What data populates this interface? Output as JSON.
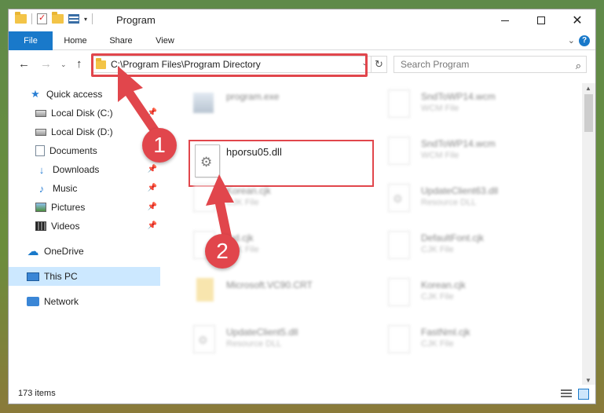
{
  "window": {
    "title": "Program",
    "minimize_glyph": "",
    "maximize_glyph": "",
    "close_glyph": "✕"
  },
  "ribbon": {
    "file": "File",
    "home": "Home",
    "share": "Share",
    "view": "View",
    "expand": "⌄",
    "help": "?"
  },
  "nav": {
    "back": "←",
    "forward": "→",
    "recent": "⌄",
    "up": "↑",
    "address": "C:\\Program Files\\Program Directory",
    "address_dropdown": "⌄",
    "refresh": "↻",
    "search_placeholder": "Search Program",
    "search_icon": "⌕"
  },
  "sidebar": {
    "items": [
      {
        "label": "Quick access",
        "icon": "star-icon"
      },
      {
        "label": "Local Disk (C:)",
        "icon": "drive-icon",
        "pinned": true
      },
      {
        "label": "Local Disk (D:)",
        "icon": "drive-icon"
      },
      {
        "label": "Documents",
        "icon": "documents-icon",
        "pinned": true
      },
      {
        "label": "Downloads",
        "icon": "download-icon",
        "pinned": true
      },
      {
        "label": "Music",
        "icon": "music-icon",
        "pinned": true
      },
      {
        "label": "Pictures",
        "icon": "pictures-icon",
        "pinned": true
      },
      {
        "label": "Videos",
        "icon": "videos-icon",
        "pinned": true
      },
      {
        "label": "OneDrive",
        "icon": "cloud-icon"
      },
      {
        "label": "This PC",
        "icon": "pc-icon",
        "selected": true
      },
      {
        "label": "Network",
        "icon": "network-icon"
      }
    ],
    "pin_glyph": "📌"
  },
  "files": {
    "left": [
      {
        "name": "program.exe",
        "type": ""
      },
      {
        "name": "hporsu05.dll",
        "type": ""
      },
      {
        "name": "Korean.cjk",
        "type": "CJK File"
      },
      {
        "name": "Ind.cjk",
        "type": "CJK File"
      },
      {
        "name": "Microsoft.VC90.CRT",
        "type": ""
      },
      {
        "name": "UpdateClient5.dll",
        "type": "Resource DLL"
      }
    ],
    "right": [
      {
        "name": "SndToWP14.wcm",
        "type": "WCM File"
      },
      {
        "name": "SndToWP14.wcm",
        "type": "WCM File"
      },
      {
        "name": "UpdateClient63.dll",
        "type": "Resource DLL"
      },
      {
        "name": "DefaultFont.cjk",
        "type": "CJK File"
      },
      {
        "name": "Korean.cjk",
        "type": "CJK File"
      },
      {
        "name": "FastNml.cjk",
        "type": "CJK File"
      }
    ]
  },
  "status": {
    "items_count": "173 items"
  },
  "annotations": {
    "step1": "1",
    "step2": "2",
    "color": "#e1464c"
  },
  "scroll": {
    "up": "▲",
    "down": "▼"
  }
}
